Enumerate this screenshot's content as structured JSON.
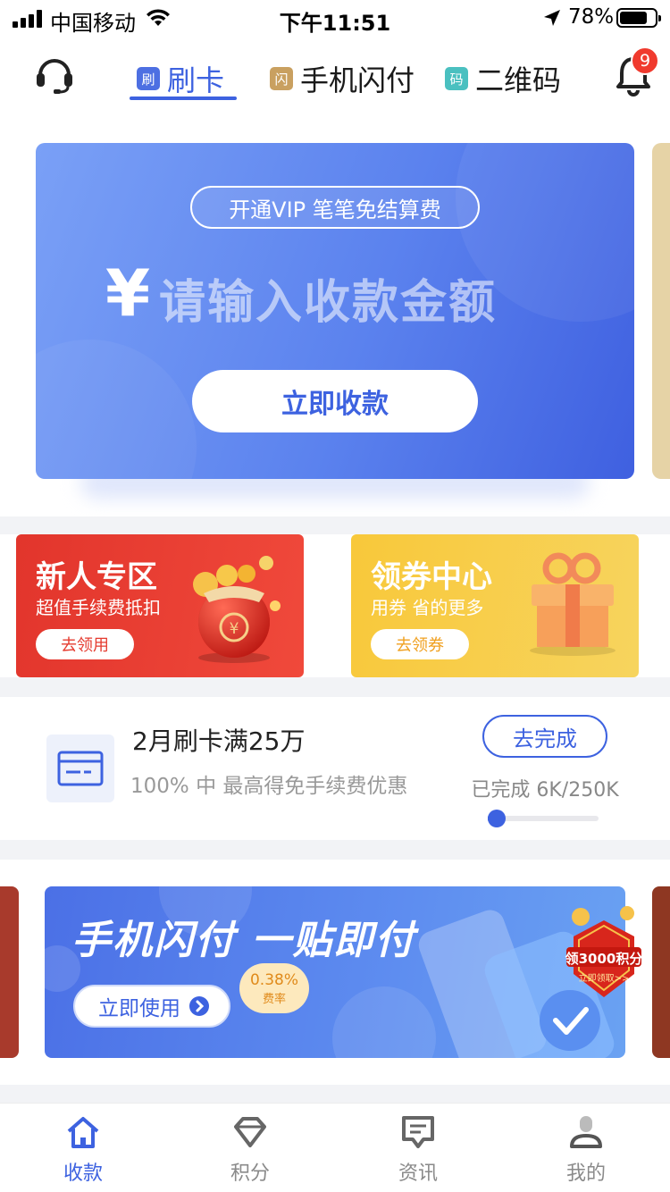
{
  "status_bar": {
    "carrier": "中国移动",
    "time": "下午11:51",
    "battery_pct": "78%",
    "battery_level": 0.78
  },
  "header": {
    "tabs": [
      {
        "badge": "刷",
        "label": "刷卡",
        "badge_color": "#4d6fe2",
        "active": true
      },
      {
        "badge": "闪",
        "label": "手机闪付",
        "badge_color": "#c9a060",
        "active": false
      },
      {
        "badge": "码",
        "label": "二维码",
        "badge_color": "#4ac0c0",
        "active": false
      }
    ],
    "notification_count": "9",
    "icons": {
      "left": "headset-icon",
      "right": "bell-icon"
    }
  },
  "hero": {
    "vip_text": "开通VIP 笔笔免结算费",
    "currency_symbol": "¥",
    "amount_placeholder": "请输入收款金额",
    "collect_button": "立即收款"
  },
  "promos": [
    {
      "title": "新人专区",
      "subtitle": "超值手续费抵扣",
      "button": "去领用",
      "button_color": "#e53b2f"
    },
    {
      "title": "领券中心",
      "subtitle": "用券 省的更多",
      "button": "去领券",
      "button_color": "#f0a020"
    }
  ],
  "task": {
    "title": "2月刷卡满25万",
    "description": "100% 中 最高得免手续费优惠",
    "button": "去完成",
    "progress_text": "已完成 6K/250K",
    "progress": 0.024
  },
  "banner": {
    "title": "手机闪付 一贴即付",
    "button": "立即使用",
    "rate_value": "0.38%",
    "rate_label": "费率",
    "points_tag": "领3000积分",
    "points_sub": "立即领取>>"
  },
  "tabbar": {
    "items": [
      {
        "label": "收款",
        "icon": "home-icon",
        "active": true
      },
      {
        "label": "积分",
        "icon": "diamond-icon",
        "active": false
      },
      {
        "label": "资讯",
        "icon": "message-icon",
        "active": false
      },
      {
        "label": "我的",
        "icon": "profile-icon",
        "active": false
      }
    ]
  },
  "colors": {
    "accent": "#3d62e0",
    "promo_red": "#e53b2f",
    "promo_yellow": "#f7c63c",
    "badge_red": "#f03a2e"
  }
}
